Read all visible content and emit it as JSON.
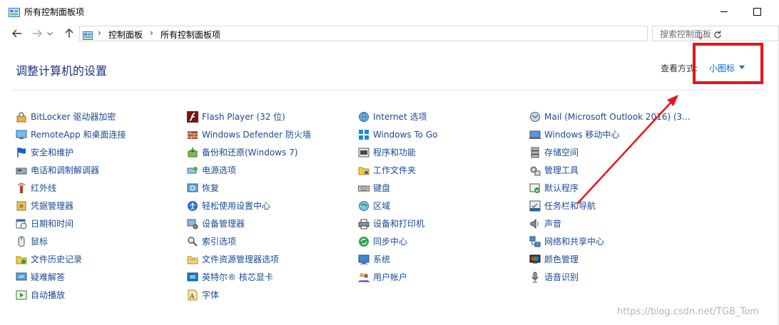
{
  "window": {
    "title": "所有控制面板项"
  },
  "address": {
    "crumbs": [
      "控制面板",
      "所有控制面板项"
    ]
  },
  "search": {
    "placeholder": "搜索控制面板"
  },
  "header": {
    "heading": "调整计算机的设置",
    "view_by_label": "查看方式:",
    "view_by_value": "小图标"
  },
  "columns": [
    [
      {
        "label": "BitLocker 驱动器加密",
        "icon": "bitlocker-icon"
      },
      {
        "label": "RemoteApp 和桌面连接",
        "icon": "remoteapp-icon"
      },
      {
        "label": "安全和维护",
        "icon": "flag-icon"
      },
      {
        "label": "电话和调制解调器",
        "icon": "phone-modem-icon"
      },
      {
        "label": "红外线",
        "icon": "infrared-icon"
      },
      {
        "label": "凭据管理器",
        "icon": "credential-icon"
      },
      {
        "label": "日期和时间",
        "icon": "calendar-clock-icon"
      },
      {
        "label": "鼠标",
        "icon": "mouse-icon"
      },
      {
        "label": "文件历史记录",
        "icon": "file-history-icon"
      },
      {
        "label": "疑难解答",
        "icon": "troubleshoot-icon"
      },
      {
        "label": "自动播放",
        "icon": "autoplay-icon"
      }
    ],
    [
      {
        "label": "Flash Player (32 位)",
        "icon": "flash-icon"
      },
      {
        "label": "Windows Defender 防火墙",
        "icon": "firewall-icon"
      },
      {
        "label": "备份和还原(Windows 7)",
        "icon": "backup-icon"
      },
      {
        "label": "电源选项",
        "icon": "power-icon"
      },
      {
        "label": "恢复",
        "icon": "recovery-icon"
      },
      {
        "label": "轻松使用设置中心",
        "icon": "ease-of-access-icon"
      },
      {
        "label": "设备管理器",
        "icon": "device-manager-icon"
      },
      {
        "label": "索引选项",
        "icon": "indexing-icon"
      },
      {
        "label": "文件资源管理器选项",
        "icon": "folder-options-icon"
      },
      {
        "label": "英特尔® 核芯显卡",
        "icon": "intel-graphics-icon"
      },
      {
        "label": "字体",
        "icon": "fonts-icon"
      }
    ],
    [
      {
        "label": "Internet 选项",
        "icon": "internet-icon"
      },
      {
        "label": "Windows To Go",
        "icon": "windows-to-go-icon"
      },
      {
        "label": "程序和功能",
        "icon": "programs-icon"
      },
      {
        "label": "工作文件夹",
        "icon": "work-folders-icon"
      },
      {
        "label": "键盘",
        "icon": "keyboard-icon"
      },
      {
        "label": "区域",
        "icon": "region-icon"
      },
      {
        "label": "设备和打印机",
        "icon": "printer-icon"
      },
      {
        "label": "同步中心",
        "icon": "sync-icon"
      },
      {
        "label": "系统",
        "icon": "system-icon"
      },
      {
        "label": "用户帐户",
        "icon": "users-icon"
      }
    ],
    [
      {
        "label": "Mail (Microsoft Outlook 2016) (3...",
        "icon": "mail-icon"
      },
      {
        "label": "Windows 移动中心",
        "icon": "mobility-icon"
      },
      {
        "label": "存储空间",
        "icon": "storage-icon"
      },
      {
        "label": "管理工具",
        "icon": "admin-tools-icon"
      },
      {
        "label": "默认程序",
        "icon": "default-programs-icon"
      },
      {
        "label": "任务栏和导航",
        "icon": "taskbar-icon"
      },
      {
        "label": "声音",
        "icon": "speaker-icon"
      },
      {
        "label": "网络和共享中心",
        "icon": "network-icon"
      },
      {
        "label": "颜色管理",
        "icon": "color-management-icon"
      },
      {
        "label": "语音识别",
        "icon": "microphone-icon"
      }
    ]
  ],
  "watermark": "https://blog.csdn.net/TGB_Tom"
}
